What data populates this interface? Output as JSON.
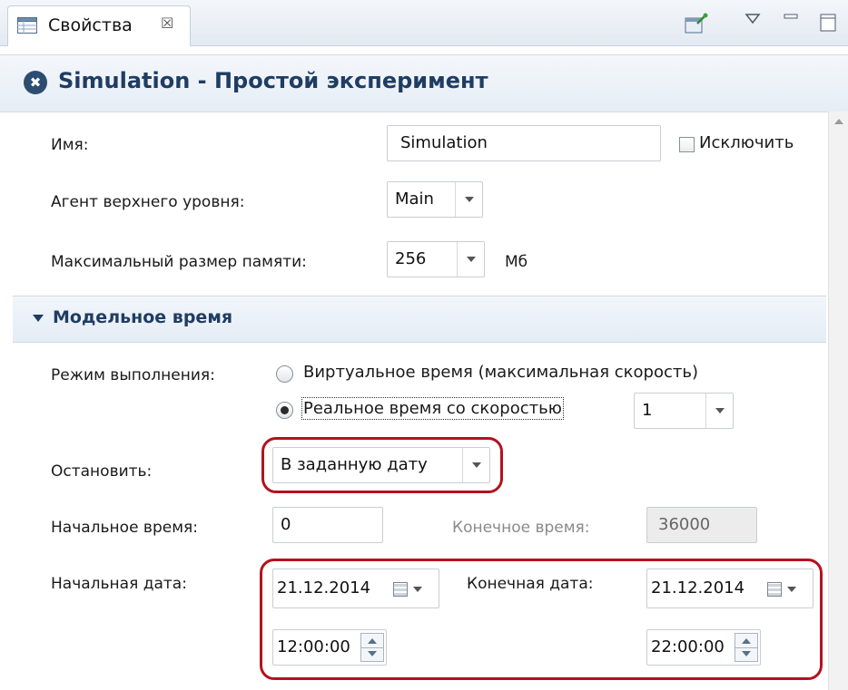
{
  "tab": {
    "title": "Свойства",
    "close_glyph": "☒",
    "icon": "properties-table-icon",
    "toolbar_icons": [
      "pin-editor-icon",
      "view-menu-icon",
      "minimize-icon",
      "maximize-icon"
    ]
  },
  "header": {
    "title": "Simulation - Простой эксперимент",
    "icon_glyph": "✖",
    "icon": "experiment-icon"
  },
  "form": {
    "name_label": "Имя:",
    "name_value": "Simulation",
    "exclude_label": "Исключить",
    "exclude_checked": false,
    "top_agent_label": "Агент верхнего уровня:",
    "top_agent_value": "Main",
    "max_memory_label": "Максимальный размер памяти:",
    "max_memory_value": "256",
    "memory_unit": "Мб"
  },
  "section": {
    "title": "Модельное время",
    "expanded": true
  },
  "model_time": {
    "mode_label": "Режим выполнения:",
    "option_virtual": "Виртуальное время (максимальная скорость)",
    "option_realtime": "Реальное время со скоростью",
    "selected_option": "realtime",
    "speed_value": "1",
    "stop_label": "Остановить:",
    "stop_value": "В заданную дату",
    "start_time_label": "Начальное время:",
    "start_time_value": "0",
    "end_time_label": "Конечное время:",
    "end_time_value": "36000",
    "start_date_label": "Начальная дата:",
    "start_date_value": "21.12.2014",
    "start_clock_value": "12:00:00",
    "end_date_label": "Конечная дата:",
    "end_date_value": "21.12.2014",
    "end_clock_value": "22:00:00"
  },
  "colors": {
    "highlight": "#b3121f",
    "title_text": "#1f3d63"
  }
}
